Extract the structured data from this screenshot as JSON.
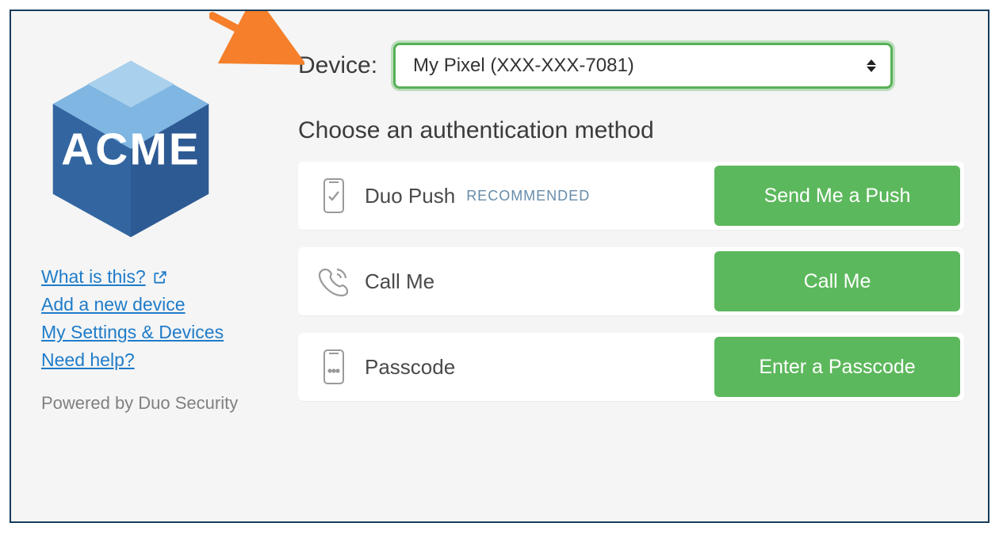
{
  "sidebar": {
    "logo_text": "ACME",
    "links": {
      "what_is_this": "What is this?",
      "add_device": "Add a new device",
      "settings_devices": "My Settings & Devices",
      "need_help": "Need help?"
    },
    "powered": "Powered by Duo Security"
  },
  "main": {
    "device_label": "Device:",
    "device_selected": "My Pixel (XXX-XXX-7081)",
    "choose_heading": "Choose an authentication method",
    "methods": {
      "push": {
        "label": "Duo Push",
        "badge": "RECOMMENDED",
        "button": "Send Me a Push"
      },
      "call": {
        "label": "Call Me",
        "button": "Call Me"
      },
      "passcode": {
        "label": "Passcode",
        "button": "Enter a Passcode"
      }
    }
  },
  "colors": {
    "accent_green": "#5cb85c",
    "link_blue": "#1f7cc9",
    "arrow_orange": "#f57f2a"
  }
}
